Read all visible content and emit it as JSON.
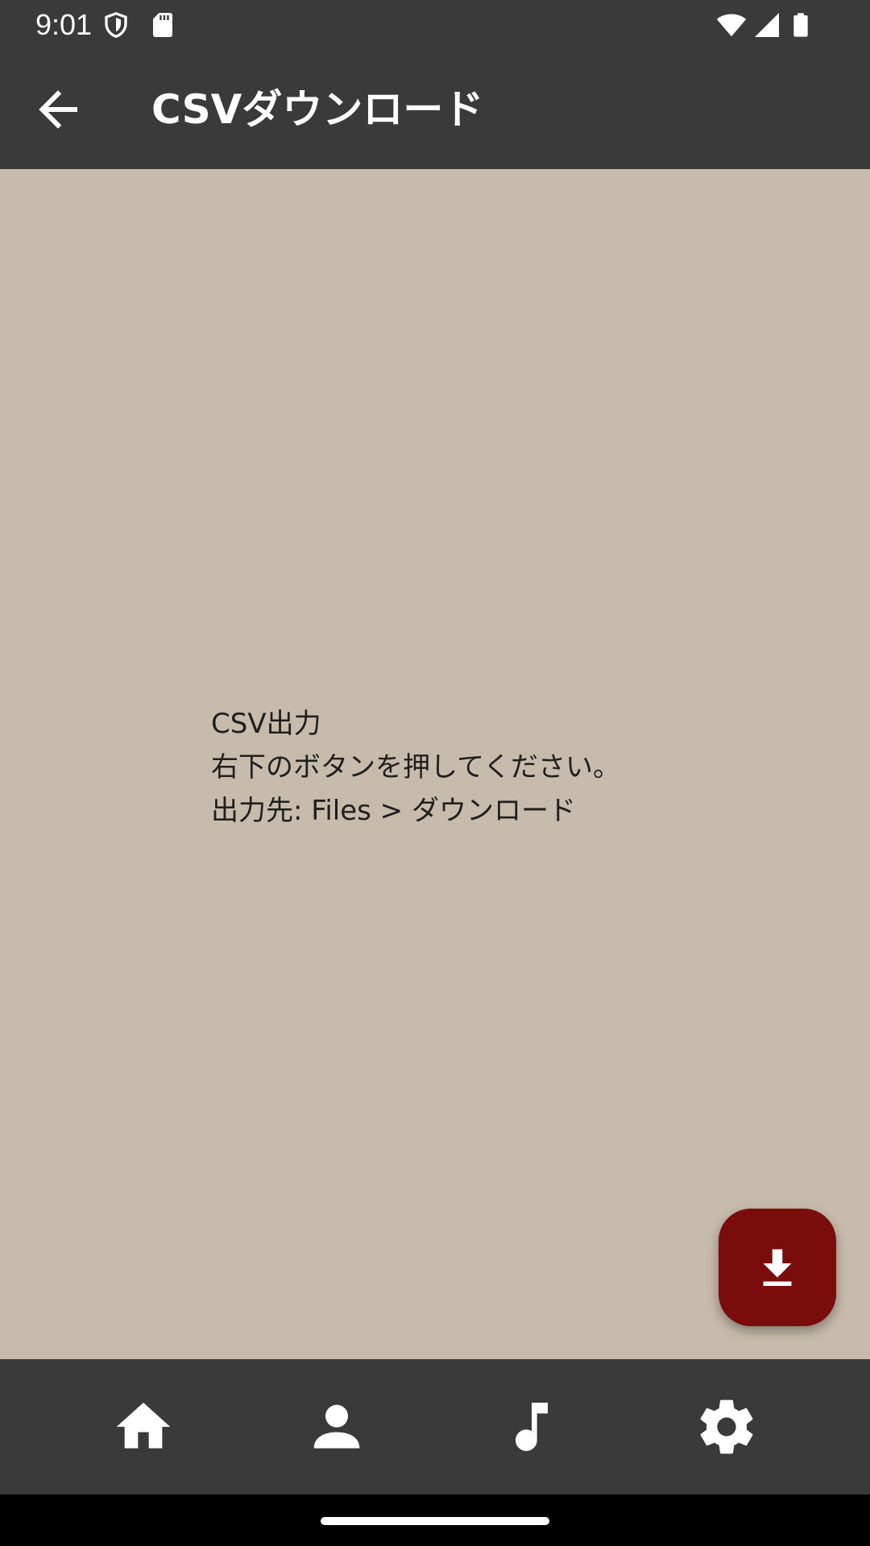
{
  "status_bar": {
    "time": "9:01",
    "icons": [
      "shield-icon",
      "sd-card-icon",
      "wifi-icon",
      "cell-signal-icon",
      "battery-icon"
    ]
  },
  "app_bar": {
    "back_icon": "arrow-back-icon",
    "title": "CSVダウンロード"
  },
  "main": {
    "lines": [
      "CSV出力",
      "右下のボタンを押してください。",
      "出力先: Files > ダウンロード"
    ]
  },
  "fab": {
    "icon": "download-icon",
    "color": "#7b0c0c"
  },
  "bottom_nav": {
    "items": [
      {
        "icon": "home-icon"
      },
      {
        "icon": "person-icon"
      },
      {
        "icon": "music-note-icon"
      },
      {
        "icon": "settings-icon"
      }
    ]
  },
  "colors": {
    "bar_background": "#3a3a3a",
    "content_background": "#c7bcab",
    "text": "#1f1f1f"
  }
}
